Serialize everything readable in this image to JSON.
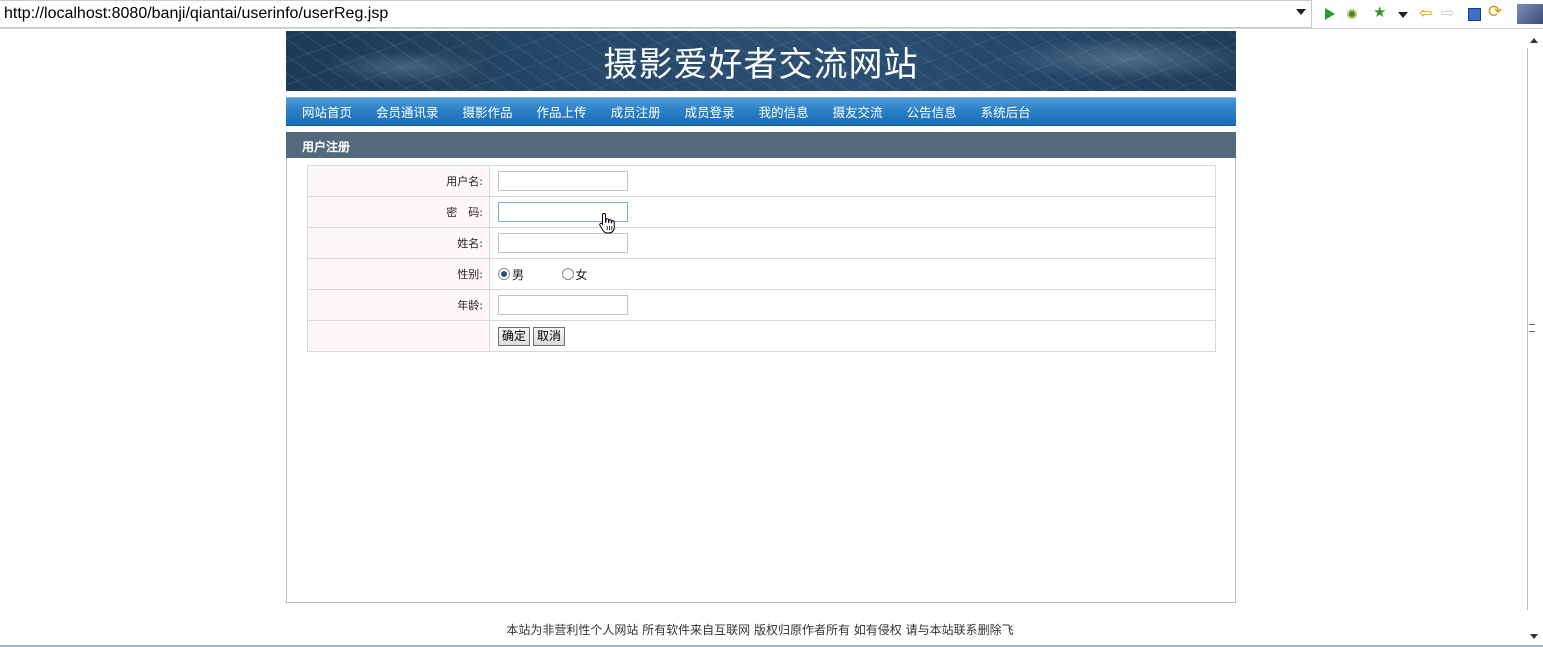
{
  "browser": {
    "url": "http://localhost:8080/banji/qiantai/userinfo/userReg.jsp",
    "toolbar_icons": [
      "run-icon",
      "debug-icon",
      "external-tools-icon",
      "back-icon",
      "forward-icon",
      "stop-icon",
      "refresh-icon"
    ]
  },
  "site": {
    "banner_title": "摄影爱好者交流网站",
    "nav": [
      {
        "label": "网站首页"
      },
      {
        "label": "会员通讯录"
      },
      {
        "label": "摄影作品"
      },
      {
        "label": "作品上传"
      },
      {
        "label": "成员注册"
      },
      {
        "label": "成员登录"
      },
      {
        "label": "我的信息"
      },
      {
        "label": "摄友交流"
      },
      {
        "label": "公告信息"
      },
      {
        "label": "系统后台"
      }
    ]
  },
  "panel": {
    "title": "用户注册",
    "form": {
      "username_label": "用户名:",
      "password_label": "密　码:",
      "realname_label": "姓名:",
      "gender_label": "性别:",
      "gender_options": [
        "男",
        "女"
      ],
      "gender_selected": "男",
      "age_label": "年龄:",
      "submit_label": "确定",
      "cancel_label": "取消"
    }
  },
  "footer": {
    "text": "本站为非营利性个人网站  所有软件来自互联网  版权归原作者所有  如有侵权  请与本站联系删除飞"
  },
  "colors": {
    "nav_blue": "#2b80c8",
    "panel_head": "#546a7c",
    "label_bg": "#fdf7fb"
  }
}
